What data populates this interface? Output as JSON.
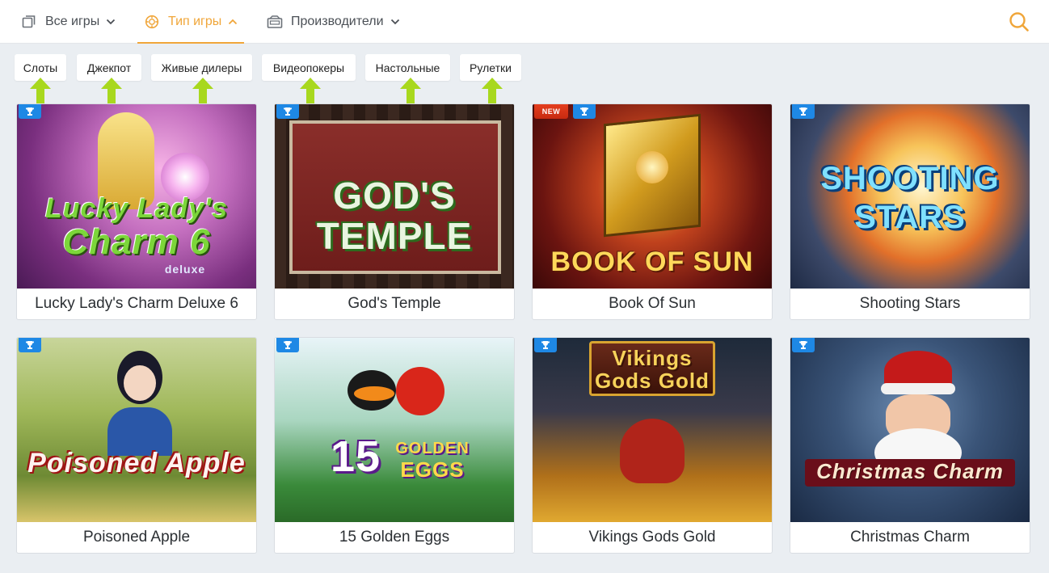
{
  "nav": {
    "all_games": "Все игры",
    "game_type": "Тип игры",
    "providers": "Производители"
  },
  "filters": [
    "Слоты",
    "Джекпот",
    "Живые дилеры",
    "Видеопокеры",
    "Настольные",
    "Рулетки"
  ],
  "colors": {
    "accent": "#f0a63a",
    "trophy": "#1e88e5",
    "arrow": "#a8d81e",
    "new_badge": "#d9321a"
  },
  "games": [
    {
      "title": "Lucky Lady's Charm Deluxe 6",
      "art_lines": [
        "Lucky Lady's",
        "Charm 6",
        "deluxe"
      ],
      "new": false
    },
    {
      "title": "God's Temple",
      "art_lines": [
        "GOD'S",
        "TEMPLE"
      ],
      "new": false
    },
    {
      "title": "Book Of Sun",
      "art_lines": [
        "BOOK OF SUN"
      ],
      "new": true,
      "new_label": "NEW"
    },
    {
      "title": "Shooting Stars",
      "art_lines": [
        "SHOOTING",
        "STARS"
      ],
      "new": false
    },
    {
      "title": "Poisoned Apple",
      "art_lines": [
        "Poisoned Apple"
      ],
      "new": false
    },
    {
      "title": "15 Golden Eggs",
      "art_lines": [
        "15",
        "GOLDEN",
        "EGGS"
      ],
      "new": false
    },
    {
      "title": "Vikings Gods Gold",
      "art_lines": [
        "Vikings",
        "Gods Gold"
      ],
      "new": false
    },
    {
      "title": "Christmas Charm",
      "art_lines": [
        "Christmas Charm"
      ],
      "new": false
    }
  ]
}
